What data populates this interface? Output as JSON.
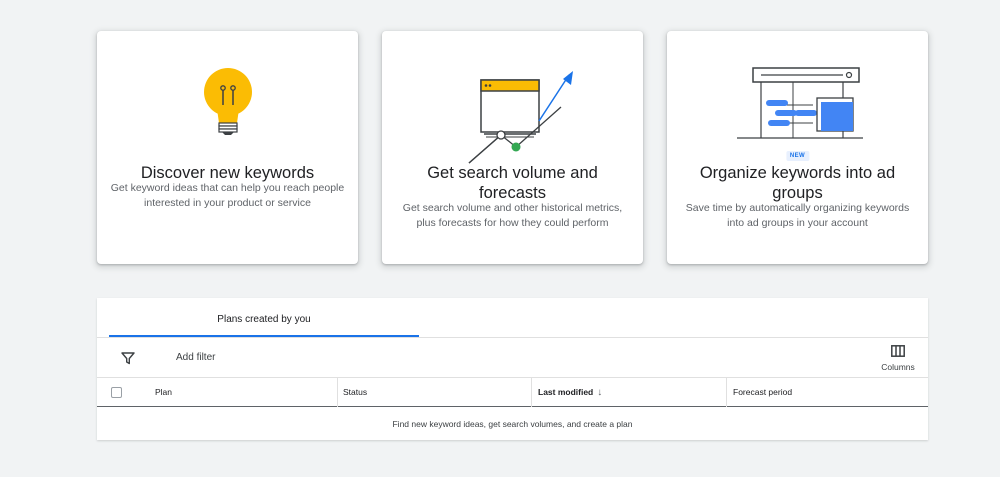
{
  "cards": [
    {
      "title": "Discover new keywords",
      "description": "Get keyword ideas that can help you reach people interested in your product or service",
      "icon": "lightbulb-icon"
    },
    {
      "title": "Get search volume and forecasts",
      "description": "Get search volume and other historical metrics, plus forecasts for how they could perform",
      "icon": "trend-chart-icon"
    },
    {
      "title": "Organize keywords into ad groups",
      "description": "Save time by automatically organizing keywords into ad groups in your account",
      "badge": "NEW",
      "icon": "ad-groups-diagram-icon"
    }
  ],
  "plans": {
    "tab_label": "Plans created by you",
    "add_filter": "Add filter",
    "columns_label": "Columns",
    "columns": {
      "plan": "Plan",
      "status": "Status",
      "last_modified": "Last modified",
      "forecast_period": "Forecast period"
    },
    "sort_arrow": "↓",
    "empty_message": "Find new keyword ideas, get search volumes, and create a plan"
  },
  "colors": {
    "background": "#f1f3f4",
    "accent": "#1a73e8",
    "yellow": "#fbbc04",
    "green": "#34a853",
    "blue": "#4285f4"
  }
}
